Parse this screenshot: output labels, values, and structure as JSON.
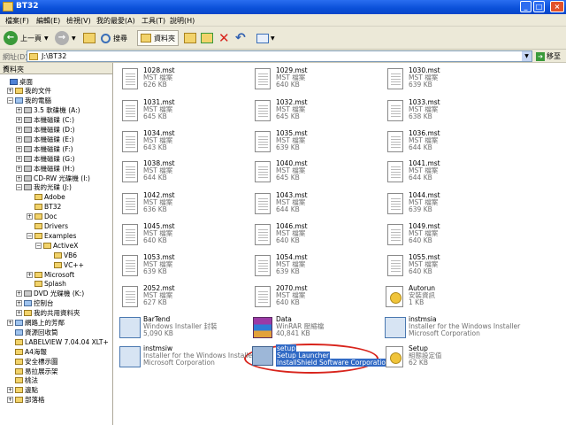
{
  "window": {
    "title": "BT32",
    "buttons": [
      "_",
      "□",
      "×"
    ]
  },
  "menu": [
    "檔案(F)",
    "編輯(E)",
    "檢視(V)",
    "我的最愛(A)",
    "工具(T)",
    "說明(H)"
  ],
  "toolbar": {
    "back": "上一頁",
    "search": "搜尋",
    "folders": "資料夾"
  },
  "address": {
    "label": "網址(D)",
    "path": "J:\\BT32",
    "go": "移至"
  },
  "folder_pane": {
    "title": "資料夾",
    "close": "×",
    "items": [
      {
        "label": "桌面",
        "exp": "",
        "icon": "blue"
      },
      {
        "label": "我的文件",
        "exp": "+",
        "icon": "folder"
      },
      {
        "label": "我的電腦",
        "exp": "−",
        "icon": "pc"
      },
      {
        "label": "3.5 軟碟機 (A:)",
        "exp": "+",
        "icon": "drive"
      },
      {
        "label": "本機磁碟 (C:)",
        "exp": "+",
        "icon": "drive"
      },
      {
        "label": "本機磁碟 (D:)",
        "exp": "+",
        "icon": "drive"
      },
      {
        "label": "本機磁碟 (E:)",
        "exp": "+",
        "icon": "drive"
      },
      {
        "label": "本機磁碟 (F:)",
        "exp": "+",
        "icon": "drive"
      },
      {
        "label": "本機磁碟 (G:)",
        "exp": "+",
        "icon": "drive"
      },
      {
        "label": "本機磁碟 (H:)",
        "exp": "+",
        "icon": "drive"
      },
      {
        "label": "CD-RW 光碟機 (I:)",
        "exp": "+",
        "icon": "drive"
      },
      {
        "label": "我的光碟 (J:)",
        "exp": "−",
        "icon": "drive"
      },
      {
        "label": "Adobe",
        "exp": "",
        "icon": "folder"
      },
      {
        "label": "BT32",
        "exp": "",
        "icon": "folder"
      },
      {
        "label": "Doc",
        "exp": "+",
        "icon": "folder"
      },
      {
        "label": "Drivers",
        "exp": "",
        "icon": "folder"
      },
      {
        "label": "Examples",
        "exp": "−",
        "icon": "folder"
      },
      {
        "label": "ActiveX",
        "exp": "−",
        "icon": "folder"
      },
      {
        "label": "VB6",
        "exp": "",
        "icon": "folder"
      },
      {
        "label": "VC++",
        "exp": "",
        "icon": "folder"
      },
      {
        "label": "Microsoft",
        "exp": "+",
        "icon": "folder"
      },
      {
        "label": "Splash",
        "exp": "",
        "icon": "folder"
      },
      {
        "label": "DVD 光碟機 (K:)",
        "exp": "+",
        "icon": "drive"
      },
      {
        "label": "控制台",
        "exp": "+",
        "icon": "pc"
      },
      {
        "label": "我的共用資料夾",
        "exp": "+",
        "icon": "folder"
      },
      {
        "label": "網路上的芳鄰",
        "exp": "+",
        "icon": "pc"
      },
      {
        "label": "資源回收筒",
        "exp": "",
        "icon": "pc"
      },
      {
        "label": "LABELVIEW 7.04.04 XLT+",
        "exp": "",
        "icon": "folder"
      },
      {
        "label": "A4海報",
        "exp": "",
        "icon": "folder"
      },
      {
        "label": "安全標示圖",
        "exp": "",
        "icon": "folder"
      },
      {
        "label": "易拉展示架",
        "exp": "",
        "icon": "folder"
      },
      {
        "label": "桃法",
        "exp": "",
        "icon": "folder"
      },
      {
        "label": "邊點",
        "exp": "+",
        "icon": "folder"
      },
      {
        "label": "部落格",
        "exp": "+",
        "icon": "folder"
      }
    ]
  },
  "files": [
    {
      "name": "1028.mst",
      "type": "MST 檔案",
      "size": "626 KB",
      "icon": "doc"
    },
    {
      "name": "1029.mst",
      "type": "MST 檔案",
      "size": "640 KB",
      "icon": "doc"
    },
    {
      "name": "1030.mst",
      "type": "MST 檔案",
      "size": "639 KB",
      "icon": "doc"
    },
    {
      "name": "1031.mst",
      "type": "MST 檔案",
      "size": "645 KB",
      "icon": "doc"
    },
    {
      "name": "1032.mst",
      "type": "MST 檔案",
      "size": "645 KB",
      "icon": "doc"
    },
    {
      "name": "1033.mst",
      "type": "MST 檔案",
      "size": "638 KB",
      "icon": "doc"
    },
    {
      "name": "1034.mst",
      "type": "MST 檔案",
      "size": "643 KB",
      "icon": "doc"
    },
    {
      "name": "1035.mst",
      "type": "MST 檔案",
      "size": "639 KB",
      "icon": "doc"
    },
    {
      "name": "1036.mst",
      "type": "MST 檔案",
      "size": "644 KB",
      "icon": "doc"
    },
    {
      "name": "1038.mst",
      "type": "MST 檔案",
      "size": "644 KB",
      "icon": "doc"
    },
    {
      "name": "1040.mst",
      "type": "MST 檔案",
      "size": "645 KB",
      "icon": "doc"
    },
    {
      "name": "1041.mst",
      "type": "MST 檔案",
      "size": "644 KB",
      "icon": "doc"
    },
    {
      "name": "1042.mst",
      "type": "MST 檔案",
      "size": "636 KB",
      "icon": "doc"
    },
    {
      "name": "1043.mst",
      "type": "MST 檔案",
      "size": "644 KB",
      "icon": "doc"
    },
    {
      "name": "1044.mst",
      "type": "MST 檔案",
      "size": "639 KB",
      "icon": "doc"
    },
    {
      "name": "1045.mst",
      "type": "MST 檔案",
      "size": "640 KB",
      "icon": "doc"
    },
    {
      "name": "1046.mst",
      "type": "MST 檔案",
      "size": "640 KB",
      "icon": "doc"
    },
    {
      "name": "1049.mst",
      "type": "MST 檔案",
      "size": "640 KB",
      "icon": "doc"
    },
    {
      "name": "1053.mst",
      "type": "MST 檔案",
      "size": "639 KB",
      "icon": "doc"
    },
    {
      "name": "1054.mst",
      "type": "MST 檔案",
      "size": "639 KB",
      "icon": "doc"
    },
    {
      "name": "1055.mst",
      "type": "MST 檔案",
      "size": "640 KB",
      "icon": "doc"
    },
    {
      "name": "2052.mst",
      "type": "MST 檔案",
      "size": "627 KB",
      "icon": "doc"
    },
    {
      "name": "2070.mst",
      "type": "MST 檔案",
      "size": "640 KB",
      "icon": "doc"
    },
    {
      "name": "Autorun",
      "type": "安裝資訊",
      "size": "1 KB",
      "icon": "cfg"
    },
    {
      "name": "BarTend",
      "type": "Windows Installer 封裝",
      "size": "5,090 KB",
      "icon": "generic"
    },
    {
      "name": "Data",
      "type": "WinRAR 壓縮檔",
      "size": "40,841 KB",
      "icon": "rar"
    },
    {
      "name": "instmsia",
      "type": "Installer for the Windows Installer",
      "size": "Microsoft Corporation",
      "icon": "generic"
    },
    {
      "name": "instmsiw",
      "type": "Installer for the Windows Installer",
      "size": "Microsoft Corporation",
      "icon": "generic"
    },
    {
      "name": "setup",
      "type": "Setup Launcher",
      "size": "InstallShield Software Corporation",
      "icon": "setup",
      "selected": true
    },
    {
      "name": "Setup",
      "type": "組態設定值",
      "size": "62 KB",
      "icon": "cfg"
    }
  ],
  "colors": {
    "selection": "#316ac5",
    "annotation": "#d8241c"
  }
}
